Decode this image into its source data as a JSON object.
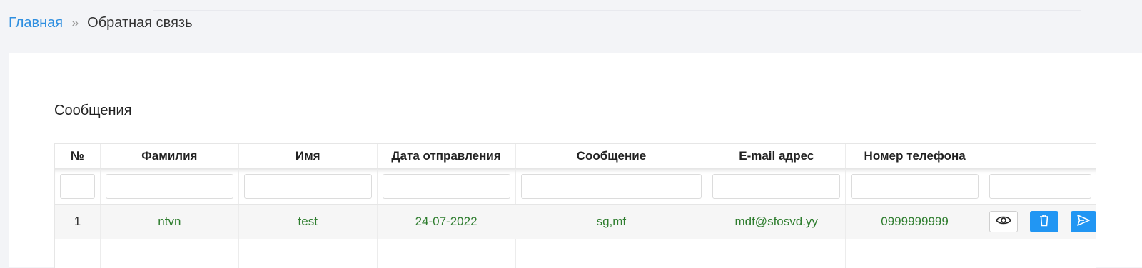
{
  "breadcrumb": {
    "home": "Главная",
    "separator": "»",
    "current": "Обратная связь"
  },
  "panel": {
    "title": "Сообщения"
  },
  "table": {
    "headers": [
      "№",
      "Фамилия",
      "Имя",
      "Дата отправления",
      "Сообщение",
      "E-mail адрес",
      "Номер телефона",
      ""
    ],
    "rows": [
      {
        "num": "1",
        "surname": "ntvn",
        "name": "test",
        "date": "24-07-2022",
        "message": "sg,mf",
        "email": "mdf@sfosvd.yy",
        "phone": "0999999999"
      }
    ],
    "actions": [
      "eye-icon",
      "trash-icon",
      "send-icon"
    ]
  },
  "colors": {
    "link": "#2f8fe0",
    "value_text": "#2e7d2e",
    "primary_button": "#2196f3"
  }
}
